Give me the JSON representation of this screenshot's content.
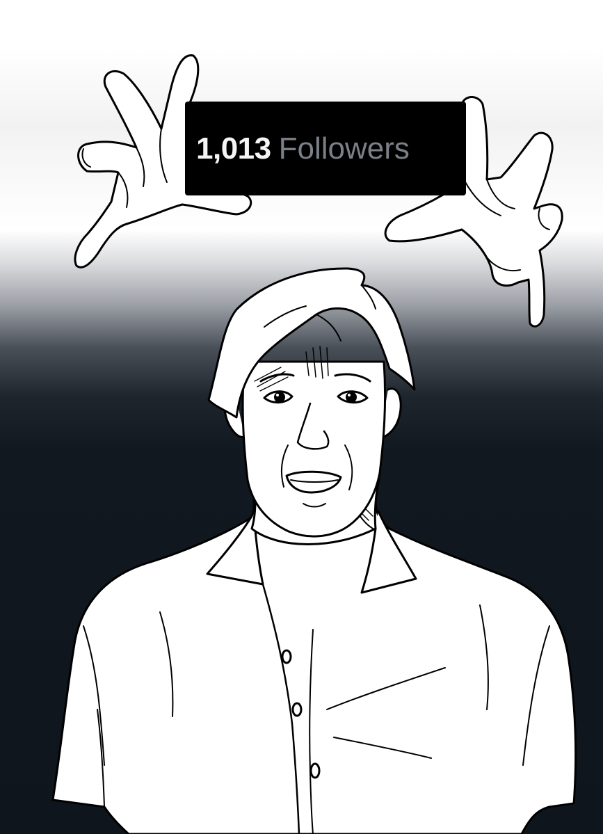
{
  "badge": {
    "count": "1,013",
    "label": "Followers"
  },
  "colors": {
    "badge_background": "#000000",
    "count_text": "#f4f4f4",
    "label_text": "#7b8088",
    "backdrop_top": "#ffffff",
    "backdrop_bottom": "#0f151c",
    "line_art": "#000000",
    "figure_fill": "#ffffff"
  }
}
